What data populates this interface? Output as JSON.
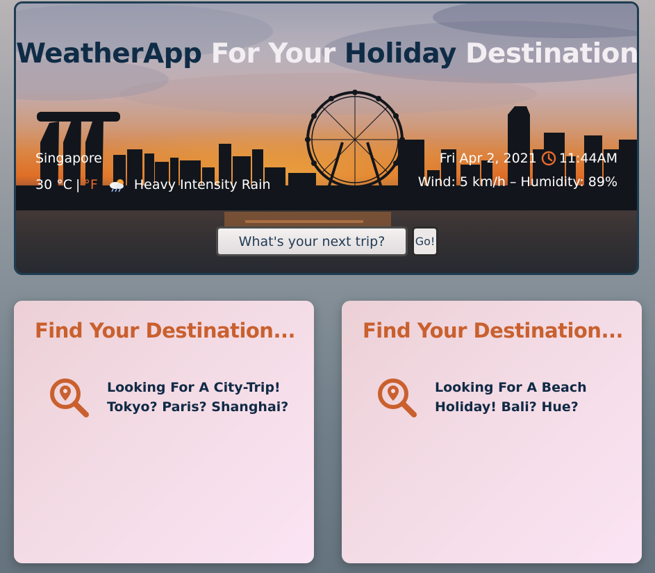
{
  "header": {
    "title_part1": "WeatherApp",
    "title_part2": "For Your",
    "title_part3": "Holiday",
    "title_part4": "Destination"
  },
  "weather": {
    "city": "Singapore",
    "temperature": "30",
    "unit_c": "°C",
    "unit_separator": "|",
    "unit_f": "°F",
    "condition": "Heavy Intensity Rain",
    "condition_icon": "rain-cloud-icon",
    "date": "Fri Apr 2, 2021",
    "time": "11:44AM",
    "time_icon": "clock-icon",
    "wind_humidity": "Wind: 5 km/h – Humidity: 89%"
  },
  "search": {
    "placeholder": "What's your next trip?",
    "go_label": "Go!"
  },
  "cards": [
    {
      "title": "Find Your Destination...",
      "icon": "search-location-icon",
      "line1": "Looking For A City-Trip!",
      "line2": "Tokyo? Paris? Shanghai?"
    },
    {
      "title": "Find Your Destination...",
      "icon": "search-location-icon",
      "line1": "Looking For A Beach",
      "line2": "Holiday! Bali? Hue?"
    }
  ],
  "colors": {
    "accent": "#c9602e",
    "navy": "#0f2c46",
    "hero_border": "#1e3d52"
  }
}
